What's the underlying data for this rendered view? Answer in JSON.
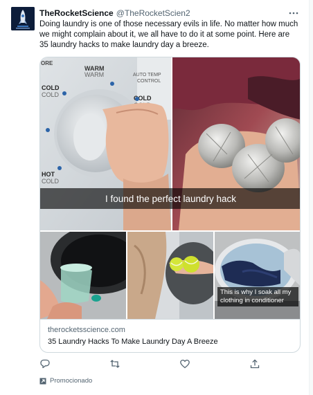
{
  "author": {
    "name": "TheRocketScience",
    "handle": "@TheRocketScien2",
    "avatar_icon": "rocket-icon"
  },
  "tweet": {
    "text": "Doing laundry is one of those necessary evils in life. No matter how much we might complain about it, we all have to do it at some point. Here are 35 laundry hacks to make laundry day a breeze."
  },
  "card": {
    "main_image": {
      "caption": "I found the perfect laundry hack",
      "dial_labels": {
        "warm": "WARM",
        "warm2": "WARM",
        "auto_temp": "AUTO TEMP",
        "control": "CONTROL",
        "cold_left": "COLD",
        "cold_left2": "COLD",
        "cold_right": "COLD",
        "cold_right2": "COLD",
        "hot": "HOT",
        "hot_cold": "COLD",
        "top_cut": "ORE"
      }
    },
    "thumbnails": [
      {
        "name": "measuring-cup-photo",
        "caption": ""
      },
      {
        "name": "tennis-balls-photo",
        "caption": ""
      },
      {
        "name": "soaking-clothes-photo",
        "caption": "This is why I soak all my clothing in conditioner"
      }
    ],
    "domain": "therocketsscience.com",
    "title": "35 Laundry Hacks To Make Laundry Day A Breeze"
  },
  "actions": [
    {
      "name": "reply-icon"
    },
    {
      "name": "retweet-icon"
    },
    {
      "name": "like-icon"
    },
    {
      "name": "share-icon"
    }
  ],
  "promoted": {
    "label": "Promocionado",
    "icon": "promoted-icon"
  },
  "colors": {
    "text_primary": "#0f1419",
    "text_secondary": "#536471",
    "border": "#cfd9de",
    "background": "#ffffff"
  }
}
